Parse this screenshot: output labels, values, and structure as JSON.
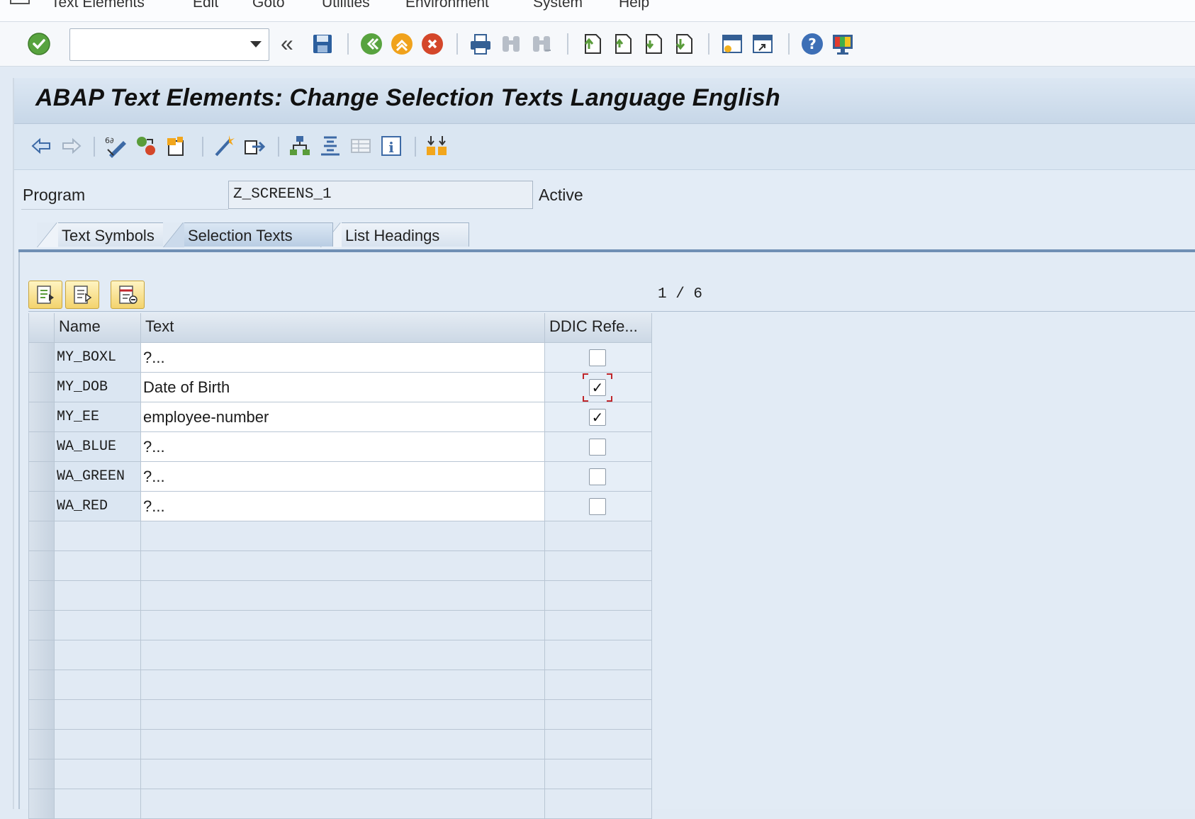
{
  "menu": {
    "items": [
      "Text Elements",
      "Edit",
      "Goto",
      "Utilities",
      "Environment",
      "System",
      "Help"
    ]
  },
  "system_toolbar": {
    "command_field_value": "",
    "icons": [
      "enter-icon",
      "dropdown-icon",
      "collapse-icon",
      "save-icon",
      "back-icon",
      "exit-icon",
      "cancel-icon",
      "print-icon",
      "find-icon",
      "find-next-icon",
      "first-page-icon",
      "previous-page-icon",
      "next-page-icon",
      "last-page-icon",
      "new-session-icon",
      "shortcut-icon",
      "help-icon",
      "customize-layout-icon"
    ]
  },
  "screen": {
    "title": "ABAP Text Elements: Change Selection Texts Language English"
  },
  "app_toolbar": {
    "icons": [
      "back-arrow-icon",
      "forward-arrow-icon",
      "display-change-icon",
      "other-object-icon",
      "where-used-icon",
      "activate-icon",
      "transport-icon",
      "hierarchy-icon",
      "pretty-print-icon",
      "layout-icon",
      "info-icon",
      "compare-icon"
    ]
  },
  "program": {
    "label": "Program",
    "value": "Z_SCREENS_1",
    "status": "Active"
  },
  "tabs": [
    {
      "label": "Text Symbols",
      "active": false
    },
    {
      "label": "Selection Texts",
      "active": true
    },
    {
      "label": "List Headings",
      "active": false
    }
  ],
  "table": {
    "pager": "1 / 6",
    "columns": [
      "Name",
      "Text",
      "DDIC Refe..."
    ],
    "rows": [
      {
        "name": "MY_BOXL",
        "text": "?...",
        "ddic": false
      },
      {
        "name": "MY_DOB",
        "text": "Date of Birth",
        "ddic": true
      },
      {
        "name": "MY_EE",
        "text": "employee-number",
        "ddic": true
      },
      {
        "name": "WA_BLUE",
        "text": "?...",
        "ddic": false
      },
      {
        "name": "WA_GREEN",
        "text": "?...",
        "ddic": false
      },
      {
        "name": "WA_RED",
        "text": "?...",
        "ddic": false
      }
    ],
    "empty_rows": 10,
    "toolbar_icons": [
      "insert-row-icon",
      "copy-row-icon",
      "delete-row-icon"
    ]
  },
  "colors": {
    "accent": "#6f8fb4",
    "ok_green": "#58a33f",
    "focus_red": "#c0262b"
  }
}
